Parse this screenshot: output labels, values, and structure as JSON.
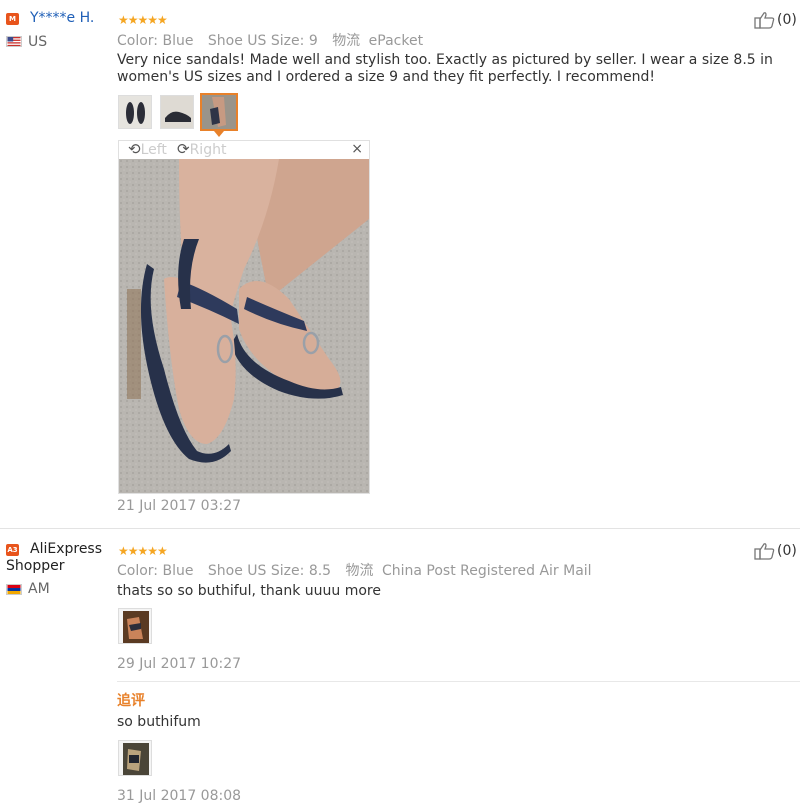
{
  "reviews": [
    {
      "badge": "M",
      "user": "Y****e H.",
      "country": "US",
      "stars": "★★★★★",
      "color_label": "Color:",
      "color_value": "Blue",
      "size_label": "Shoe US Size:",
      "size_value": "9",
      "logistics_label": "物流",
      "logistics_value": "ePacket",
      "text": "Very nice sandals! Made well and stylish too. Exactly as pictured by seller. I wear a size 8.5 in women's US sizes and I ordered a size 9 and they fit perfectly. I recommend!",
      "rotate_left": "Left",
      "rotate_right": "Right",
      "close": "×",
      "date": "21 Jul 2017 03:27",
      "likes": "(0)"
    },
    {
      "badge": "A3",
      "user": "AliExpress Shopper",
      "country": "AM",
      "stars": "★★★★★",
      "color_label": "Color:",
      "color_value": "Blue",
      "size_label": "Shoe US Size:",
      "size_value": "8.5",
      "logistics_label": "物流",
      "logistics_value": "China Post Registered Air Mail",
      "text": "thats so so buthiful, thank uuuu more",
      "date": "29 Jul 2017 10:27",
      "likes": "(0)",
      "additional_label": "追评",
      "additional_text": "so buthifum",
      "additional_date": "31 Jul 2017 08:08"
    }
  ],
  "icons": {
    "thumbs_up": "thumbs-up-icon",
    "rotate_left": "rotate-left-icon",
    "rotate_right": "rotate-right-icon",
    "close": "close-icon"
  },
  "colors": {
    "link": "#1f5fb7",
    "star": "#f5a623",
    "badge": "#e8541c",
    "accent": "#e8812a"
  }
}
